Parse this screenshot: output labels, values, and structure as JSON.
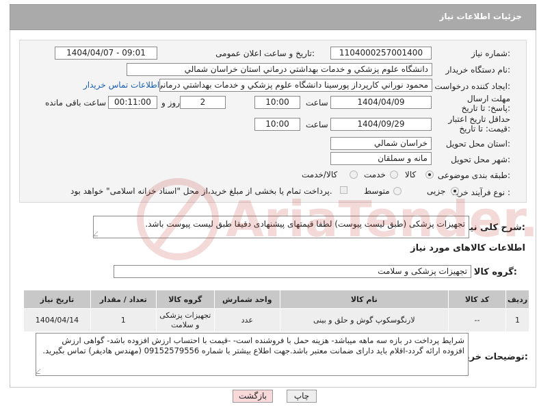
{
  "header": {
    "title": "جزئیات اطلاعات نیاز"
  },
  "fields": {
    "need_number_label": "شماره نیاز:",
    "need_number": "1104000257001400",
    "announce_label": "تاریخ و ساعت اعلان عمومی:",
    "announce_value": "1404/04/07 - 09:01",
    "buyer_label": "نام دستگاه خریدار:",
    "buyer_value": "دانشگاه علوم پزشکي و خدمات بهداشتي درماني استان خراسان شمالي",
    "creator_label": "ایجاد کننده درخواست:",
    "creator_value": "محمود نوراني کارپرداز پورسينا دانشگاه علوم پزشکي و خدمات بهداشتي درماني",
    "contact_link": "اطلاعات تماس خریدار",
    "deadline_label": "مهلت ارسال پاسخ: تا تاریخ:",
    "deadline_date": "1404/04/09",
    "time_label": "ساعت",
    "deadline_time": "10:00",
    "days_value": "2",
    "days_label": "روز و",
    "remaining_time": "00:11:00",
    "remaining_label": "ساعت باقی مانده",
    "validity_label": "حداقل تاریخ اعتبار قیمت: تا تاریخ:",
    "validity_date": "1404/09/29",
    "validity_time": "10:00",
    "province_label": "استان محل تحویل:",
    "province_value": "خراسان شمالي",
    "city_label": "شهر محل تحویل:",
    "city_value": "مانه و سملقان",
    "category_label": "طبقه بندی موضوعی:",
    "category_options": [
      "کالا",
      "خدمت",
      "کالا/خدمت"
    ],
    "category_selected": "کالا",
    "process_label": "نوع فرآیند خرید :",
    "process_options": [
      "جزیی",
      "متوسط"
    ],
    "process_selected": "جزیی",
    "payment_note": "پرداخت تمام یا بخشی از مبلغ خرید،از محل \"اسناد خزانه اسلامی\" خواهد بود."
  },
  "description": {
    "label": "شرح کلی نیاز:",
    "value": "تجهیزات پزشکی (طبق لیست پیوست) لطفا قیمتهای پیشنهادی دقیقا طبق لیست پیوست باشد."
  },
  "goods": {
    "section_title": "اطلاعات کالاهای مورد نیاز",
    "group_label": "گروه کالا:",
    "group_value": "تجهیزات پزشکی و سلامت",
    "columns": [
      "ردیف",
      "کد کالا",
      "نام کالا",
      "واحد شمارش",
      "گروه کالا",
      "تعداد / مقدار",
      "تاریخ نیاز"
    ],
    "rows": [
      [
        "1",
        "--",
        "لارنگوسکوپ گوش و حلق و بینی",
        "عدد",
        "تجهیزات پزشکی و سلامت",
        "1",
        "1404/04/14"
      ]
    ]
  },
  "buyer_notes": {
    "label": "توضیحات خریدار:",
    "value": "شرایط پرداخت در بازه سه ماهه میباشد- هزینه حمل با فروشنده است- -قیمت با احتساب ارزش افزوده  باشد- گواهی ارزش افزوده ارائه گردد-اقلام باید دارای ضمانت معتبر باشد.جهت اطلاع بیشتر با شماره 09152579556 (مهندس هادیفر) تماس بگیرید."
  },
  "buttons": {
    "print": "چاپ",
    "back": "بازگشت"
  },
  "watermark": {
    "text": "AriaTender.net"
  },
  "colors": {
    "header": "#aaaaaa",
    "link": "#1a5fb4",
    "back_button": "#f8d8d8",
    "table_header": "#c8c8c8"
  }
}
